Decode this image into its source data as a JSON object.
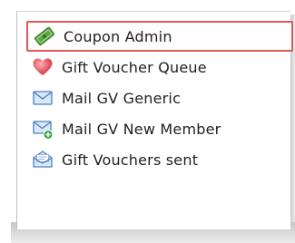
{
  "menu": {
    "items": [
      {
        "label": "Coupon Admin",
        "icon": "coupon-icon",
        "selected": true
      },
      {
        "label": "Gift Voucher Queue",
        "icon": "heart-icon",
        "selected": false
      },
      {
        "label": "Mail GV Generic",
        "icon": "envelope-icon",
        "selected": false
      },
      {
        "label": "Mail GV New Member",
        "icon": "envelope-add-icon",
        "selected": false
      },
      {
        "label": "Gift Vouchers sent",
        "icon": "envelope-open-icon",
        "selected": false
      }
    ]
  },
  "colors": {
    "selection_border": "#e05a5a",
    "coupon_green": "#4a9a3a",
    "heart_red": "#e2535d",
    "envelope_blue": "#4b80c4",
    "add_badge_green": "#3aa34a"
  }
}
